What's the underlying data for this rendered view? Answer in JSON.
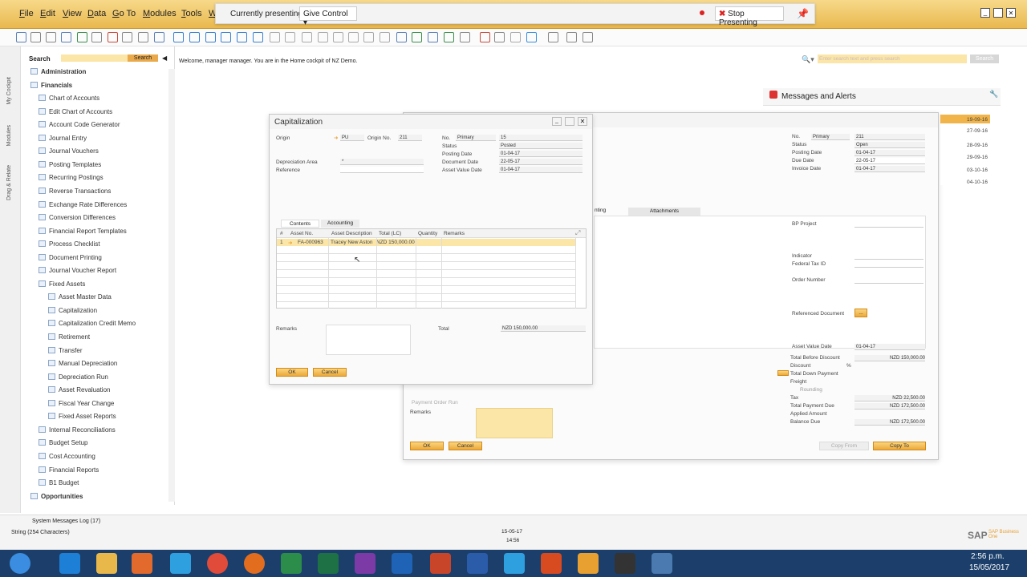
{
  "menu": [
    "File",
    "Edit",
    "View",
    "Data",
    "Go To",
    "Modules",
    "Tools",
    "W"
  ],
  "presenting": {
    "status": "Currently presenting",
    "give_control": "Give Control",
    "stop": "Stop Presenting"
  },
  "welcome": "Welcome, manager manager. You are in the Home cockpit of NZ Demo.",
  "search": {
    "label": "Search",
    "button": "Search",
    "top_placeholder": "Enter search text and press search",
    "top_button": "Search"
  },
  "vertical_tabs": [
    "My Cockpit",
    "Modules",
    "Drag & Relate"
  ],
  "tree": {
    "administration": "Administration",
    "financials": "Financials",
    "items": [
      "Chart of Accounts",
      "Edit Chart of Accounts",
      "Account Code Generator",
      "Journal Entry",
      "Journal Vouchers",
      "Posting Templates",
      "Recurring Postings",
      "Reverse Transactions",
      "Exchange Rate Differences",
      "Conversion Differences",
      "Financial Report Templates",
      "Process Checklist",
      "Document Printing",
      "Journal Voucher Report"
    ],
    "fixed_assets": "Fixed Assets",
    "fa_items": [
      "Asset Master Data",
      "Capitalization",
      "Capitalization Credit Memo",
      "Retirement",
      "Transfer",
      "Manual Depreciation",
      "Depreciation Run",
      "Asset Revaluation",
      "Fiscal Year Change",
      "Fixed Asset Reports"
    ],
    "more": [
      "Internal Reconciliations",
      "Budget Setup",
      "Cost Accounting",
      "Financial Reports",
      "B1 Budget"
    ],
    "opportunities": "Opportunities"
  },
  "messages": {
    "title": "Messages and Alerts",
    "dates": [
      "19-09-16",
      "27-09-16",
      "28-09-16",
      "29-09-16",
      "03-10-16",
      "04-10-16"
    ]
  },
  "cap": {
    "title": "Capitalization",
    "origin_label": "Origin",
    "origin_value": "PU",
    "origin_no_label": "Origin No.",
    "origin_no_value": "211",
    "dep_area_label": "Depreciation Area",
    "dep_area_value": "*",
    "reference_label": "Reference",
    "no_label": "No.",
    "series": "Primary",
    "no_value": "15",
    "status_label": "Status",
    "status_value": "Posted",
    "posting_label": "Posting Date",
    "posting_value": "01-04-17",
    "doc_label": "Document Date",
    "doc_value": "22-05-17",
    "asset_value_label": "Asset Value Date",
    "asset_value_value": "01-04-17",
    "tabs": [
      "Contents",
      "Accounting"
    ],
    "columns": [
      "#",
      "Asset No.",
      "Asset Description",
      "Total (LC)",
      "Quantity",
      "Remarks"
    ],
    "row": {
      "num": "1",
      "asset_no": "FA-000963",
      "desc": "Tracey New Aston",
      "total": "NZD 150,000.00"
    },
    "remarks_label": "Remarks",
    "total_label": "Total",
    "total_value": "NZD 150,000.00",
    "ok": "OK",
    "cancel": "Cancel"
  },
  "inv": {
    "no_label": "No.",
    "series": "Primary",
    "no_value": "211",
    "status_label": "Status",
    "status_value": "Open",
    "posting_label": "Posting Date",
    "posting_value": "01-04-17",
    "due_label": "Due Date",
    "due_value": "22-05-17",
    "invoice_label": "Invoice Date",
    "invoice_value": "01-04-17",
    "tab_partial": "nting",
    "tab_attach": "Attachments",
    "bp_project": "BP Project",
    "indicator": "Indicator",
    "federal": "Federal Tax ID",
    "order": "Order Number",
    "ref_doc": "Referenced Document",
    "asset_value_label": "Asset Value Date",
    "asset_value_value": "01-04-17",
    "tbd_label": "Total Before Discount",
    "tbd_value": "NZD 150,000.00",
    "discount_label": "Discount",
    "discount_unit": "%",
    "tdp_label": "Total Down Payment",
    "freight_label": "Freight",
    "rounding_label": "Rounding",
    "tax_label": "Tax",
    "tax_value": "NZD 22,500.00",
    "tpd_label": "Total Payment Due",
    "tpd_value": "NZD 172,500.00",
    "applied_label": "Applied Amount",
    "balance_label": "Balance Due",
    "balance_value": "NZD 172,500.00",
    "payment_order": "Payment Order Run",
    "remarks": "Remarks",
    "ok": "OK",
    "cancel": "Cancel",
    "copy_from": "Copy From",
    "copy_to": "Copy To"
  },
  "status": {
    "log": "System Messages Log (17)",
    "string": "String (254 Characters)",
    "date": "15-05-17",
    "time": "14:56",
    "brand": "SAP Business One"
  },
  "clock": {
    "time": "2:56 p.m.",
    "date": "15/05/2017"
  },
  "colors": {
    "accent": "#f0b44a",
    "highlight": "#fbe6a8",
    "taskbar": "#1b3f6a"
  }
}
